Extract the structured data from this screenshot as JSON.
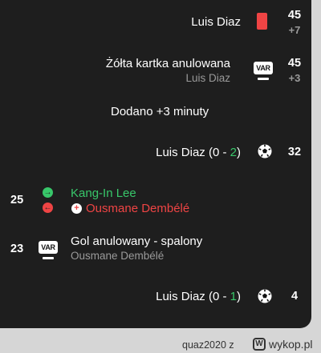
{
  "events": {
    "red_card": {
      "player": "Luis Diaz",
      "minute": "45",
      "extra": "+7"
    },
    "var_card": {
      "title": "Żółta kartka anulowana",
      "player": "Luis Diaz",
      "minute": "45",
      "extra": "+3",
      "badge": "VAR"
    },
    "added_time": {
      "label": "Dodano +3 minuty"
    },
    "goal_2": {
      "player": "Luis Diaz",
      "score_open": "(0 - ",
      "score_new": "2",
      "score_close": ")",
      "minute": "32"
    },
    "substitution": {
      "minute": "25",
      "player_in": "Kang-In Lee",
      "player_out": "Ousmane Dembélé"
    },
    "var_goal": {
      "minute": "23",
      "badge": "VAR",
      "title": "Gol anulowany - spalony",
      "player": "Ousmane Dembélé"
    },
    "goal_1": {
      "player": "Luis Diaz",
      "score_open": "(0 - ",
      "score_new": "1",
      "score_close": ")",
      "minute": "4"
    }
  },
  "icons": {
    "red_card": "red-card-icon",
    "var": "var-icon",
    "ball": "soccer-ball-icon",
    "sub_in": "arrow-right-icon",
    "sub_out": "arrow-left-icon",
    "injury": "injury-cross-icon"
  },
  "colors": {
    "background": "#1e1e1e",
    "green": "#38c76a",
    "red": "#ef4444",
    "muted": "#9a9a9a"
  },
  "footer": {
    "author": "quaz2020  z",
    "logo_text": "wykop.pl",
    "logo_glyph": "W"
  }
}
